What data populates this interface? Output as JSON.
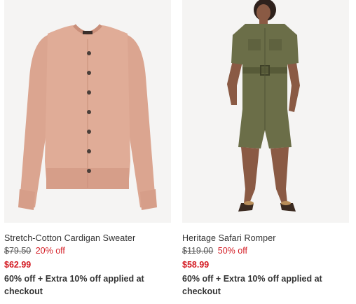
{
  "products": [
    {
      "name": "Stretch-Cotton Cardigan Sweater",
      "original_price": "$79.50",
      "discount": "20% off",
      "sale_price": "$62.99",
      "promo": "60% off + Extra 10% off applied at checkout",
      "image_color": "#e0ac97",
      "image_icon": "cardigan-image"
    },
    {
      "name": "Heritage Safari Romper",
      "original_price": "$119.00",
      "discount": "50% off",
      "sale_price": "$58.99",
      "promo": "60% off + Extra 10% off applied at checkout",
      "image_color": "#6b6e48",
      "image_icon": "romper-image"
    }
  ],
  "colors": {
    "sale_red": "#d41c24",
    "text": "#333333",
    "image_bg": "#f5f4f3"
  }
}
